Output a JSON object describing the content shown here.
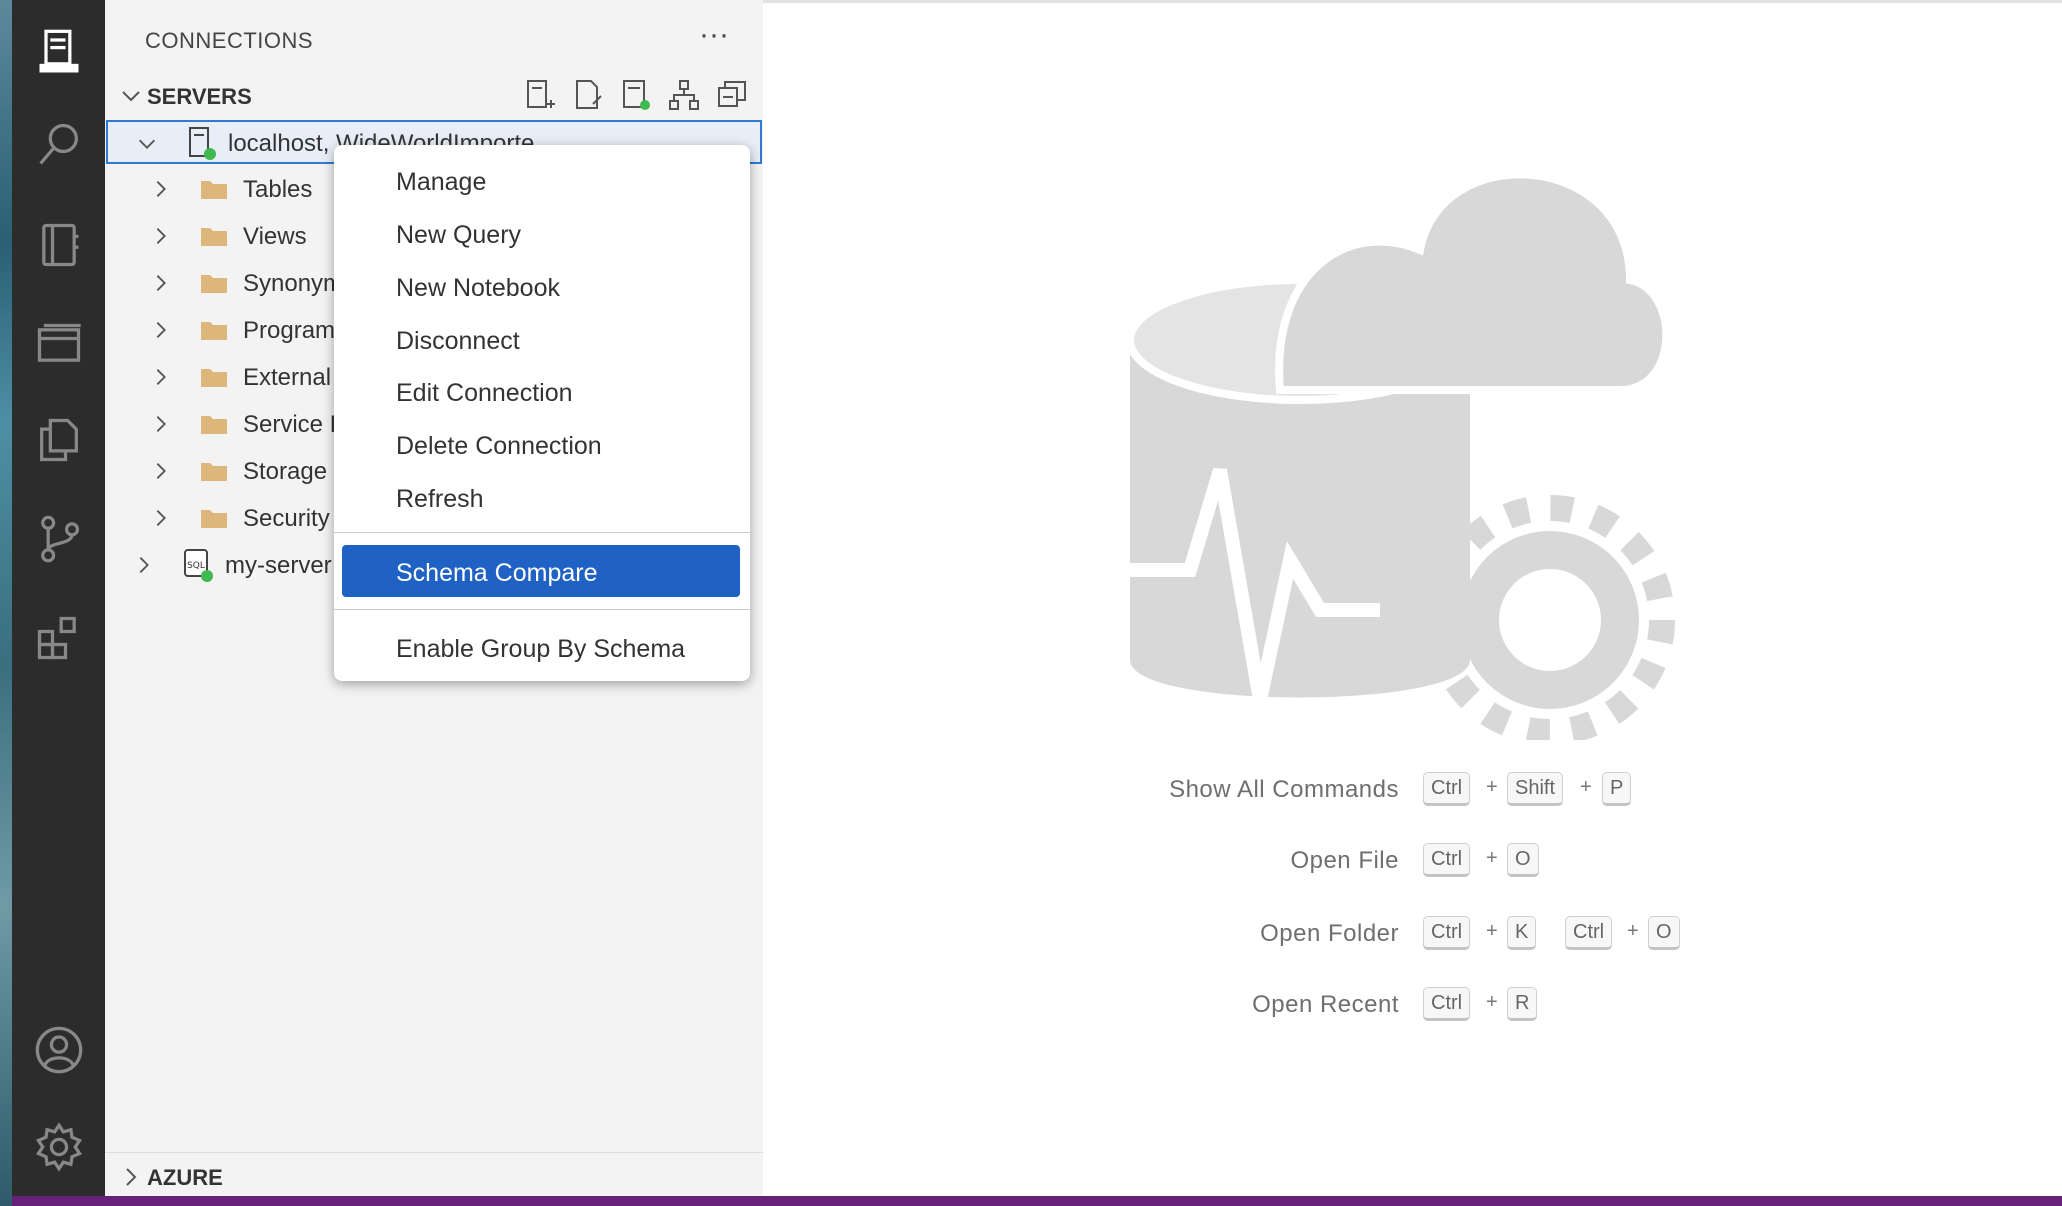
{
  "sidebar": {
    "title": "CONNECTIONS",
    "more_label": "···",
    "servers_label": "SERVERS",
    "azure_label": "AZURE",
    "server_row_label": "localhost, WideWorldImporte",
    "second_server_label": "my-server",
    "tree_items": [
      {
        "label": "Tables"
      },
      {
        "label": "Views"
      },
      {
        "label": "Synonym"
      },
      {
        "label": "Program"
      },
      {
        "label": "External"
      },
      {
        "label": "Service E"
      },
      {
        "label": "Storage"
      },
      {
        "label": "Security"
      }
    ],
    "server_icon_badge": "SQL"
  },
  "menu": {
    "items": [
      {
        "label": "Manage"
      },
      {
        "label": "New Query"
      },
      {
        "label": "New Notebook"
      },
      {
        "label": "Disconnect"
      },
      {
        "label": "Edit Connection"
      },
      {
        "label": "Delete Connection"
      },
      {
        "label": "Refresh"
      }
    ],
    "selected": {
      "label": "Schema Compare"
    },
    "last": {
      "label": "Enable Group By Schema"
    }
  },
  "shortcuts": [
    {
      "label": "Show All Commands",
      "keys": [
        "Ctrl",
        "+",
        "Shift",
        "+",
        "P"
      ]
    },
    {
      "label": "Open File",
      "keys": [
        "Ctrl",
        "+",
        "O"
      ]
    },
    {
      "label": "Open Folder",
      "keys": [
        "Ctrl",
        "+",
        "K",
        "Ctrl",
        "+",
        "O"
      ]
    },
    {
      "label": "Open Recent",
      "keys": [
        "Ctrl",
        "+",
        "R"
      ]
    }
  ],
  "colors": {
    "accent": "#1f62c4",
    "status_bar": "#68217a",
    "activity_bar": "#2c2c2c",
    "sidebar_bg": "#f3f3f3",
    "connected_dot": "#3fb950",
    "folder": "#dcb67a"
  },
  "icons": {
    "activity": [
      "connections-icon",
      "search-icon",
      "notebooks-icon",
      "dashboard-icon",
      "explorer-icon",
      "source-control-icon",
      "extensions-icon",
      "account-icon",
      "settings-gear-icon"
    ]
  }
}
